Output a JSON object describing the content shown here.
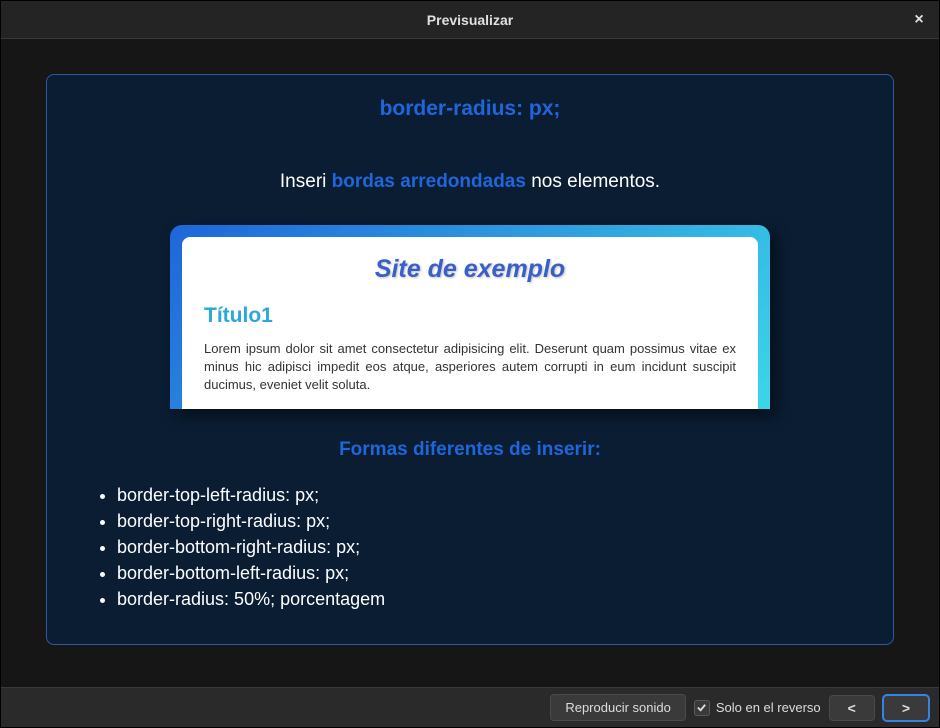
{
  "window": {
    "title": "Previsualizar",
    "close_glyph": "×"
  },
  "card": {
    "title": "border-radius: px;",
    "desc_pre": "Inseri ",
    "desc_highlight": "bordas arredondadas",
    "desc_post": " nos elementos.",
    "example": {
      "site_title": "Site de exemplo",
      "heading": "Título1",
      "body": "Lorem ipsum dolor sit amet consectetur adipisicing elit. Deserunt quam possimus vitae ex minus hic adipisci impedit eos atque, asperiores autem corrupti in eum incidunt suscipit ducimus, eveniet velit soluta."
    },
    "subheading": "Formas diferentes de inserir:",
    "list": [
      "border-top-left-radius: px;",
      "border-top-right-radius: px;",
      "border-bottom-right-radius: px;",
      "border-bottom-left-radius: px;",
      "border-radius: 50%; porcentagem"
    ]
  },
  "footer": {
    "play_label": "Reproducir sonido",
    "checkbox_label": "Solo en el reverso",
    "checkbox_checked": true,
    "prev_glyph": "<",
    "next_glyph": ">"
  }
}
